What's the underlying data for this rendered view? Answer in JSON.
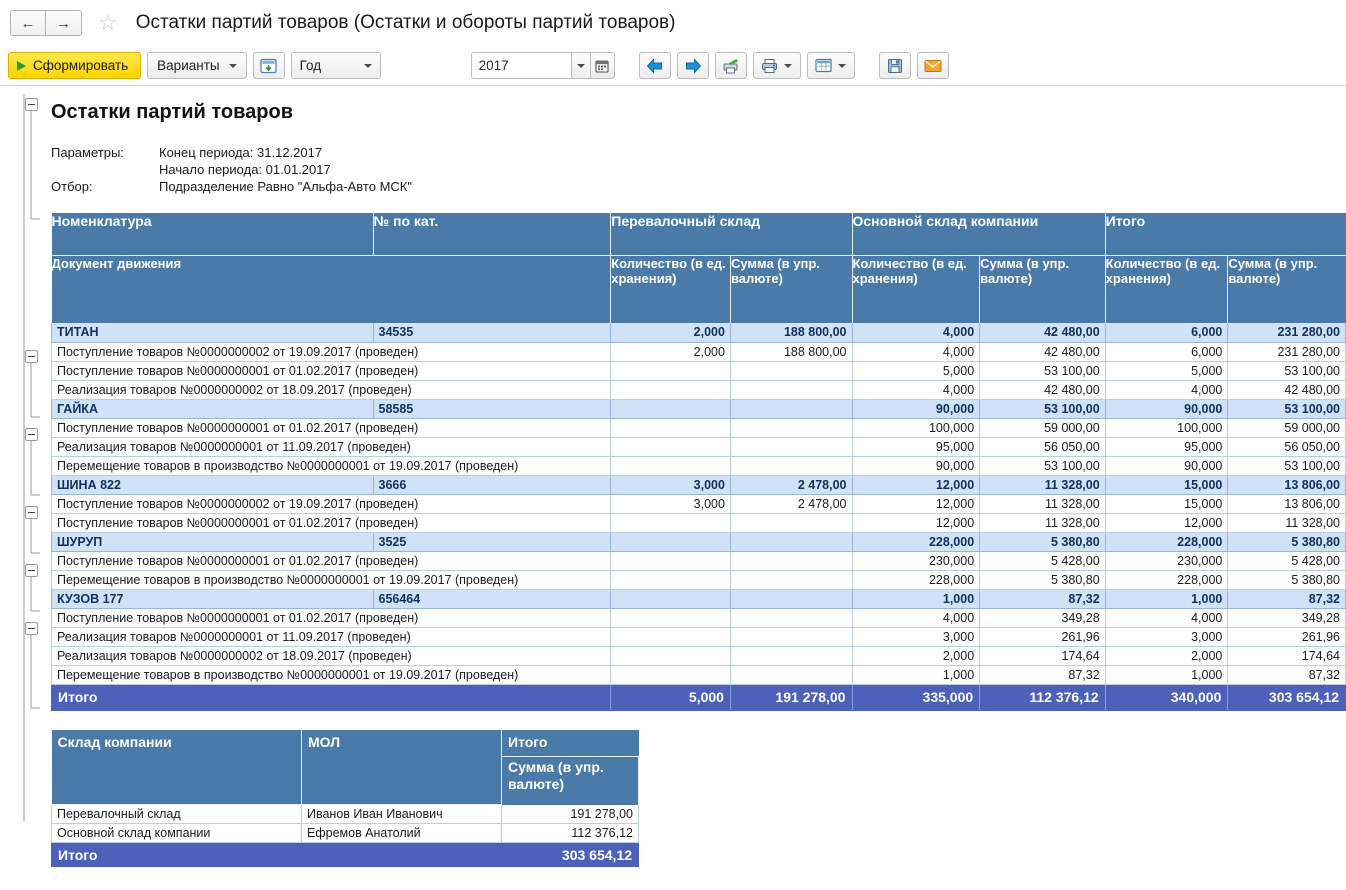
{
  "window": {
    "title": "Остатки партий товаров (Остатки и обороты партий товаров)",
    "back_icon": "←",
    "forward_icon": "→",
    "favorite_icon": "☆"
  },
  "toolbar": {
    "generate_label": "Сформировать",
    "variants_label": "Варианты",
    "settings_icon": "settings-panel-icon",
    "period_value": "Год",
    "year_value": "2017",
    "year_placeholder": "2017",
    "calendar_icon": "calendar-icon",
    "prev_icon": "arrow-left-blue-icon",
    "next_icon": "arrow-right-blue-icon",
    "print_preview_icon": "print-check-icon",
    "print_icon": "printer-icon",
    "table_icon": "table-view-icon",
    "save_icon": "floppy-save-icon",
    "mail_icon": "envelope-icon"
  },
  "report": {
    "title": "Остатки партий товаров",
    "params_label": "Параметры:",
    "params_lines": [
      "Конец периода: 31.12.2017",
      "Начало периода: 01.01.2017"
    ],
    "filter_label": "Отбор:",
    "filter_value": "Подразделение Равно \"Альфа-Авто МСК\""
  },
  "table": {
    "group_headers": {
      "nomenclature": "Номенклатура",
      "catalog_no": "№ по кат.",
      "warehouse_1": "Перевалочный склад",
      "warehouse_2": "Основной склад компании",
      "total": "Итого"
    },
    "sub_headers": {
      "document": "Документ движения",
      "qty": "Количество (в ед. хранения)",
      "sum": "Сумма (в упр. валюте)"
    },
    "rows": [
      {
        "type": "group",
        "name": "ТИТАН",
        "catalog": "34535",
        "w1_qty": "2,000",
        "w1_sum": "188 800,00",
        "w2_qty": "4,000",
        "w2_sum": "42 480,00",
        "t_qty": "6,000",
        "t_sum": "231 280,00"
      },
      {
        "type": "detail",
        "name": "Поступление товаров №0000000002 от 19.09.2017 (проведен)",
        "catalog": "",
        "w1_qty": "2,000",
        "w1_sum": "188 800,00",
        "w2_qty": "4,000",
        "w2_sum": "42 480,00",
        "t_qty": "6,000",
        "t_sum": "231 280,00"
      },
      {
        "type": "detail",
        "name": "Поступление товаров №0000000001 от 01.02.2017 (проведен)",
        "catalog": "",
        "w1_qty": "",
        "w1_sum": "",
        "w2_qty": "5,000",
        "w2_sum": "53 100,00",
        "t_qty": "5,000",
        "t_sum": "53 100,00"
      },
      {
        "type": "detail",
        "name": "Реализация товаров №0000000002 от 18.09.2017 (проведен)",
        "catalog": "",
        "w1_qty": "",
        "w1_sum": "",
        "w2_qty": "4,000",
        "w2_sum": "42 480,00",
        "t_qty": "4,000",
        "t_sum": "42 480,00"
      },
      {
        "type": "group",
        "name": "ГАЙКА",
        "catalog": "58585",
        "w1_qty": "",
        "w1_sum": "",
        "w2_qty": "90,000",
        "w2_sum": "53 100,00",
        "t_qty": "90,000",
        "t_sum": "53 100,00"
      },
      {
        "type": "detail",
        "name": "Поступление товаров №0000000001 от 01.02.2017 (проведен)",
        "catalog": "",
        "w1_qty": "",
        "w1_sum": "",
        "w2_qty": "100,000",
        "w2_sum": "59 000,00",
        "t_qty": "100,000",
        "t_sum": "59 000,00"
      },
      {
        "type": "detail",
        "name": "Реализация товаров №0000000001 от 11.09.2017 (проведен)",
        "catalog": "",
        "w1_qty": "",
        "w1_sum": "",
        "w2_qty": "95,000",
        "w2_sum": "56 050,00",
        "t_qty": "95,000",
        "t_sum": "56 050,00"
      },
      {
        "type": "detail",
        "name": "Перемещение товаров в производство №0000000001 от 19.09.2017 (проведен)",
        "catalog": "",
        "w1_qty": "",
        "w1_sum": "",
        "w2_qty": "90,000",
        "w2_sum": "53 100,00",
        "t_qty": "90,000",
        "t_sum": "53 100,00"
      },
      {
        "type": "group",
        "name": "ШИНА 822",
        "catalog": "3666",
        "w1_qty": "3,000",
        "w1_sum": "2 478,00",
        "w2_qty": "12,000",
        "w2_sum": "11 328,00",
        "t_qty": "15,000",
        "t_sum": "13 806,00"
      },
      {
        "type": "detail",
        "name": "Поступление товаров №0000000002 от 19.09.2017 (проведен)",
        "catalog": "",
        "w1_qty": "3,000",
        "w1_sum": "2 478,00",
        "w2_qty": "12,000",
        "w2_sum": "11 328,00",
        "t_qty": "15,000",
        "t_sum": "13 806,00"
      },
      {
        "type": "detail",
        "name": "Поступление товаров №0000000001 от 01.02.2017 (проведен)",
        "catalog": "",
        "w1_qty": "",
        "w1_sum": "",
        "w2_qty": "12,000",
        "w2_sum": "11 328,00",
        "t_qty": "12,000",
        "t_sum": "11 328,00"
      },
      {
        "type": "group",
        "name": "ШУРУП",
        "catalog": "3525",
        "w1_qty": "",
        "w1_sum": "",
        "w2_qty": "228,000",
        "w2_sum": "5 380,80",
        "t_qty": "228,000",
        "t_sum": "5 380,80"
      },
      {
        "type": "detail",
        "name": "Поступление товаров №0000000001 от 01.02.2017 (проведен)",
        "catalog": "",
        "w1_qty": "",
        "w1_sum": "",
        "w2_qty": "230,000",
        "w2_sum": "5 428,00",
        "t_qty": "230,000",
        "t_sum": "5 428,00"
      },
      {
        "type": "detail",
        "name": "Перемещение товаров в производство №0000000001 от 19.09.2017 (проведен)",
        "catalog": "",
        "w1_qty": "",
        "w1_sum": "",
        "w2_qty": "228,000",
        "w2_sum": "5 380,80",
        "t_qty": "228,000",
        "t_sum": "5 380,80"
      },
      {
        "type": "group",
        "name": "КУЗОВ 177",
        "catalog": "656464",
        "w1_qty": "",
        "w1_sum": "",
        "w2_qty": "1,000",
        "w2_sum": "87,32",
        "t_qty": "1,000",
        "t_sum": "87,32"
      },
      {
        "type": "detail",
        "name": "Поступление товаров №0000000001 от 01.02.2017 (проведен)",
        "catalog": "",
        "w1_qty": "",
        "w1_sum": "",
        "w2_qty": "4,000",
        "w2_sum": "349,28",
        "t_qty": "4,000",
        "t_sum": "349,28"
      },
      {
        "type": "detail",
        "name": "Реализация товаров №0000000001 от 11.09.2017 (проведен)",
        "catalog": "",
        "w1_qty": "",
        "w1_sum": "",
        "w2_qty": "3,000",
        "w2_sum": "261,96",
        "t_qty": "3,000",
        "t_sum": "261,96"
      },
      {
        "type": "detail",
        "name": "Реализация товаров №0000000002 от 18.09.2017 (проведен)",
        "catalog": "",
        "w1_qty": "",
        "w1_sum": "",
        "w2_qty": "2,000",
        "w2_sum": "174,64",
        "t_qty": "2,000",
        "t_sum": "174,64"
      },
      {
        "type": "detail",
        "name": "Перемещение товаров в производство №0000000001 от 19.09.2017 (проведен)",
        "catalog": "",
        "w1_qty": "",
        "w1_sum": "",
        "w2_qty": "1,000",
        "w2_sum": "87,32",
        "t_qty": "1,000",
        "t_sum": "87,32"
      }
    ],
    "total_row": {
      "label": "Итого",
      "w1_qty": "5,000",
      "w1_sum": "191 278,00",
      "w2_qty": "335,000",
      "w2_sum": "112 376,12",
      "t_qty": "340,000",
      "t_sum": "303 654,12"
    }
  },
  "table2": {
    "headers": {
      "warehouse": "Склад компании",
      "mol": "МОЛ",
      "total": "Итого",
      "total_sub": "Сумма (в упр. валюте)"
    },
    "rows": [
      {
        "warehouse": "Перевалочный склад",
        "mol": "Иванов Иван Иванович",
        "sum": "191 278,00"
      },
      {
        "warehouse": "Основной склад компании",
        "mol": "Ефремов Анатолий",
        "sum": "112 376,12"
      }
    ],
    "total_row": {
      "label": "Итого",
      "sum": "303 654,12"
    }
  },
  "colors": {
    "header_blue": "#4a7aa8",
    "group_row": "#cfe2f7",
    "total_row": "#4d61ba",
    "generate_yellow": "#ffd400"
  }
}
